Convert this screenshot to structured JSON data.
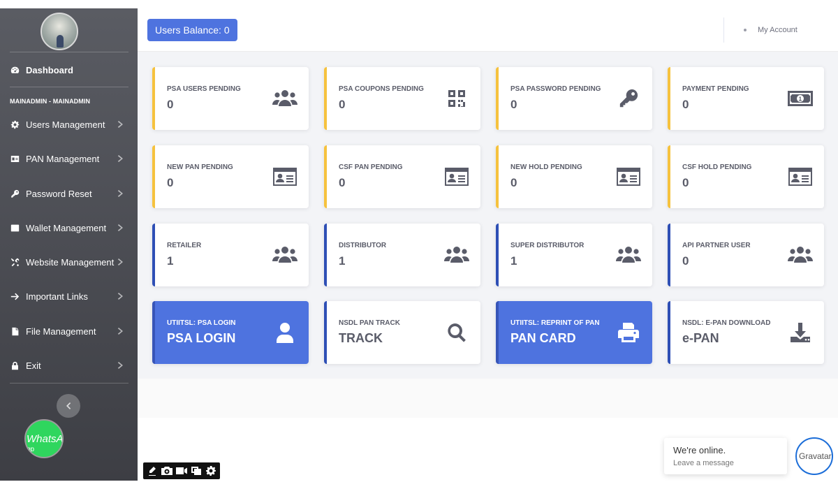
{
  "sidebar": {
    "dashboard": "Dashboard",
    "heading": "MAINADMIN - MAINADMIN",
    "items": [
      {
        "label": "Users Management",
        "icon": "gear-icon"
      },
      {
        "label": "PAN Management",
        "icon": "id-card-icon"
      },
      {
        "label": "Password Reset",
        "icon": "key-icon"
      },
      {
        "label": "Wallet Management",
        "icon": "wallet-icon"
      },
      {
        "label": "Website Management",
        "icon": "tools-icon"
      },
      {
        "label": "Important Links",
        "icon": "arrow-right-icon"
      },
      {
        "label": "File Management",
        "icon": "file-icon"
      },
      {
        "label": "Exit",
        "icon": "lock-icon"
      }
    ],
    "whatsapp_alt": "WhatsA",
    "whatsapp_sub": "pp"
  },
  "topbar": {
    "balance_label": "Users Balance: 0",
    "account_label": "My Account"
  },
  "cards": [
    {
      "label": "PSA USERS PENDING",
      "value": "0",
      "icon": "users-icon"
    },
    {
      "label": "PSA COUPONS PENDING",
      "value": "0",
      "icon": "qrcode-icon"
    },
    {
      "label": "PSA PASSWORD PENDING",
      "value": "0",
      "icon": "key-icon"
    },
    {
      "label": "PAYMENT PENDING",
      "value": "0",
      "icon": "money-bill-icon"
    },
    {
      "label": "NEW PAN PENDING",
      "value": "0",
      "icon": "id-card-icon"
    },
    {
      "label": "CSF PAN PENDING",
      "value": "0",
      "icon": "id-card-icon"
    },
    {
      "label": "NEW HOLD PENDING",
      "value": "0",
      "icon": "id-card-icon"
    },
    {
      "label": "CSF HOLD PENDING",
      "value": "0",
      "icon": "id-card-icon"
    },
    {
      "label": "RETAILER",
      "value": "1",
      "icon": "users-icon"
    },
    {
      "label": "DISTRIBUTOR",
      "value": "1",
      "icon": "users-icon"
    },
    {
      "label": "SUPER DISTRIBUTOR",
      "value": "1",
      "icon": "users-icon"
    },
    {
      "label": "API PARTNER USER",
      "value": "0",
      "icon": "users-icon"
    },
    {
      "label": "UTIITSL: PSA LOGIN",
      "value": "PSA LOGIN",
      "icon": "user-icon"
    },
    {
      "label": "NSDL PAN TRACK",
      "value": "TRACK",
      "icon": "search-icon"
    },
    {
      "label": "UTIITSL: REPRINT OF PAN",
      "value": "PAN CARD",
      "icon": "print-icon"
    },
    {
      "label": "NSDL: E-PAN DOWNLOAD",
      "value": "e-PAN",
      "icon": "download-icon"
    }
  ],
  "chat": {
    "status": "We're online.",
    "prompt": "Leave a message",
    "avatar_alt": "Gravatar"
  },
  "colors": {
    "primary": "#4e73df",
    "warning": "#f6c23e",
    "dark_blue": "#2e4fb5",
    "sidebar": "#4a4b51",
    "whatsapp": "#2fd65e"
  }
}
